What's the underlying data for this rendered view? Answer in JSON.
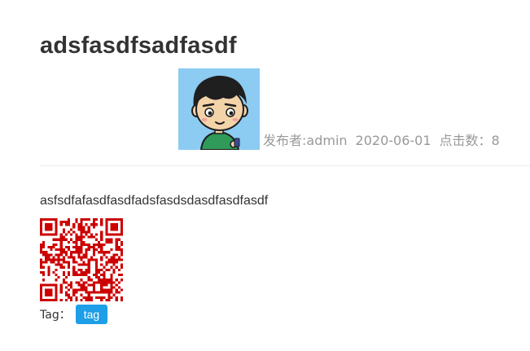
{
  "article": {
    "title": "adsfasdfsadfasdf",
    "body": "asfsdfafasdfasdfadsfasdsdasdfasdfasdf"
  },
  "meta": {
    "avatar_icon": "cartoon-boy-avatar-icon",
    "publisher": "发布者:admin",
    "date": "2020-06-01",
    "clicks": "点击数：8"
  },
  "qr": {
    "icon": "qr-code-icon",
    "color": "#cc0000"
  },
  "tags": {
    "label": "Tag：",
    "items": [
      "tag"
    ],
    "badge_color": "#1e9fe8"
  }
}
